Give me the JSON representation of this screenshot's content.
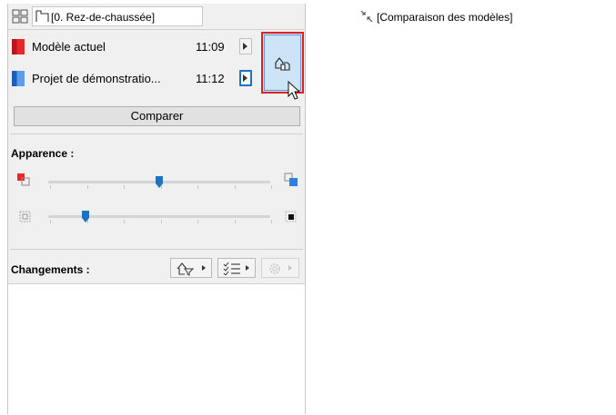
{
  "header": {
    "story_label": "[0. Rez-de-chaussée]"
  },
  "models": [
    {
      "name": "Modèle actuel",
      "time": "11:09",
      "color": "#e8272a"
    },
    {
      "name": "Projet de démonstratio...",
      "time": "11:12",
      "color": "#2f7fe0"
    }
  ],
  "compare_button": {
    "label": "Comparer"
  },
  "appearance": {
    "label": "Apparence :",
    "sliders": [
      {
        "name": "color-blend",
        "value": 0.5,
        "left_icon": "red-squares-icon",
        "right_icon": "blue-squares-icon"
      },
      {
        "name": "contrast",
        "value": 0.17,
        "left_icon": "outline-square-icon",
        "right_icon": "filled-square-icon"
      }
    ]
  },
  "changes": {
    "label": "Changements :",
    "tools": [
      {
        "icon": "shape-filter-icon",
        "enabled": true
      },
      {
        "icon": "list-filter-icon",
        "enabled": true
      },
      {
        "icon": "gear-icon",
        "enabled": false
      }
    ]
  },
  "right_view": {
    "title": "[Comparaison des modèles]"
  },
  "colors": {
    "accent_blue": "#1e73be",
    "highlight_red": "#e02020",
    "panel_bg": "#f0f0f0"
  }
}
